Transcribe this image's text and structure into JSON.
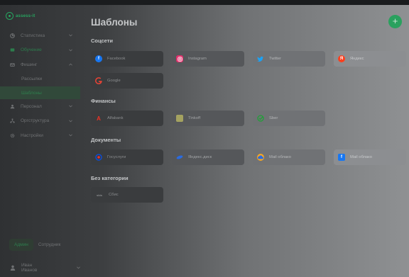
{
  "app": {
    "brand": "assess-it"
  },
  "sidebar": {
    "items": [
      {
        "label": "Статистика",
        "icon": "chart-icon",
        "expandable": true
      },
      {
        "label": "Обучение",
        "icon": "education-icon",
        "expandable": true,
        "highlight": true
      },
      {
        "label": "Фишинг",
        "icon": "phishing-icon",
        "expandable": true,
        "expanded": true
      },
      {
        "label": "Рассылки",
        "sub": true
      },
      {
        "label": "Шаблоны",
        "sub": true,
        "active": true
      },
      {
        "label": "Персонал",
        "icon": "people-icon",
        "expandable": true
      },
      {
        "label": "Оргструктура",
        "icon": "org-icon",
        "expandable": true
      },
      {
        "label": "Настройки",
        "icon": "gear-icon",
        "expandable": true
      }
    ],
    "role_toggle": {
      "admin": "Админ",
      "employee": "Сотрудник",
      "selected": "admin"
    },
    "user": {
      "name": "Иван Иванов"
    }
  },
  "main": {
    "title": "Шаблоны",
    "add_label": "+",
    "sections": [
      {
        "title": "Соцсети",
        "cards": [
          {
            "label": "Facebook",
            "icon": "facebook-icon",
            "color": "#1877f2"
          },
          {
            "label": "Instagram",
            "icon": "instagram-icon",
            "color": "#e1306c"
          },
          {
            "label": "Twitter",
            "icon": "twitter-icon",
            "color": "#1da1f2"
          },
          {
            "label": "Яндекс",
            "icon": "yandex-icon",
            "color": "#fc3f1d"
          },
          {
            "label": "Google",
            "icon": "google-icon",
            "color": "#ea4335"
          }
        ]
      },
      {
        "title": "Финансы",
        "cards": [
          {
            "label": "Alfabank",
            "icon": "alfabank-icon",
            "color": "#ef3124"
          },
          {
            "label": "Tinkoff",
            "icon": "tinkoff-icon",
            "color": "#ffdd2d"
          },
          {
            "label": "Sber",
            "icon": "sber-icon",
            "color": "#21a038"
          }
        ]
      },
      {
        "title": "Документы",
        "cards": [
          {
            "label": "Госуслуги",
            "icon": "gosuslugi-icon",
            "color": "#0d4cd3"
          },
          {
            "label": "Яндекс.диск",
            "icon": "yandex-disk-icon",
            "color": "#2a6be0"
          },
          {
            "label": "Mail облако",
            "icon": "mail-cloud-icon",
            "color": "#f5a623"
          },
          {
            "label": "Mail облако",
            "icon": "facebook-icon",
            "color": "#1877f2"
          }
        ]
      },
      {
        "title": "Без категории",
        "cards": [
          {
            "label": "Сбис",
            "icon": "sbis-icon",
            "color": "#555555"
          }
        ]
      }
    ]
  }
}
